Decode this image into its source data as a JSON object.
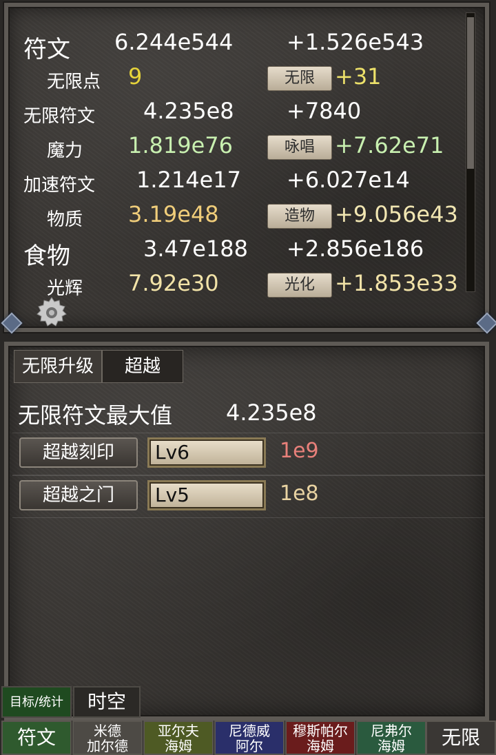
{
  "colors": {
    "white": "#ffffff",
    "yellow": "#e6d33a",
    "green": "#c8f0b0",
    "gold": "#f0cd7a",
    "cream": "#f1e6b2",
    "light_yellow": "#f2e3a8",
    "gain_yellow": "#ede16a",
    "cost_red": "#e8807a",
    "cost_gold": "#e9d3a2"
  },
  "resources": [
    {
      "name": "符文",
      "value": "6.244e544",
      "gain": "+1.526e543",
      "action": ""
    },
    {
      "name": "无限点",
      "value": "9",
      "gain": "+31",
      "action": "无限"
    },
    {
      "name": "无限符文",
      "value": "4.235e8",
      "gain": "+7840",
      "action": ""
    },
    {
      "name": "魔力",
      "value": "1.819e76",
      "gain": "+7.62e71",
      "action": "咏唱"
    },
    {
      "name": "加速符文",
      "value": "1.214e17",
      "gain": "+6.027e14",
      "action": ""
    },
    {
      "name": "物质",
      "value": "3.19e48",
      "gain": "+9.056e43",
      "action": "造物"
    },
    {
      "name": "食物",
      "value": "3.47e188",
      "gain": "+2.856e186",
      "action": ""
    },
    {
      "name": "光辉",
      "value": "7.92e30",
      "gain": "+1.853e33",
      "action": "光化"
    }
  ],
  "tabs": {
    "infinite_upgrade": "无限升级",
    "transcend": "超越"
  },
  "max_rune": {
    "label": "无限符文最大值",
    "value": "4.235e8"
  },
  "upgrades": [
    {
      "name": "超越刻印",
      "level": "Lv6",
      "cost": "1e9"
    },
    {
      "name": "超越之门",
      "level": "Lv5",
      "cost": "1e8"
    }
  ],
  "subtabs": {
    "goals": "目标/统计",
    "spacetime": "时空"
  },
  "nav": [
    {
      "line1": "符文",
      "line2": "",
      "color": "#2f5a2e"
    },
    {
      "line1": "米德",
      "line2": "加尔德",
      "color": "#4d4a45"
    },
    {
      "line1": "亚尔夫",
      "line2": "海姆",
      "color": "#4e5a24"
    },
    {
      "line1": "尼德威",
      "line2": "阿尔",
      "color": "#2a2f6a"
    },
    {
      "line1": "穆斯帕尔",
      "line2": "海姆",
      "color": "#6a1c1c"
    },
    {
      "line1": "尼弗尔",
      "line2": "海姆",
      "color": "#2a5a3e"
    },
    {
      "line1": "无限",
      "line2": "",
      "color": "#3a3734"
    }
  ]
}
